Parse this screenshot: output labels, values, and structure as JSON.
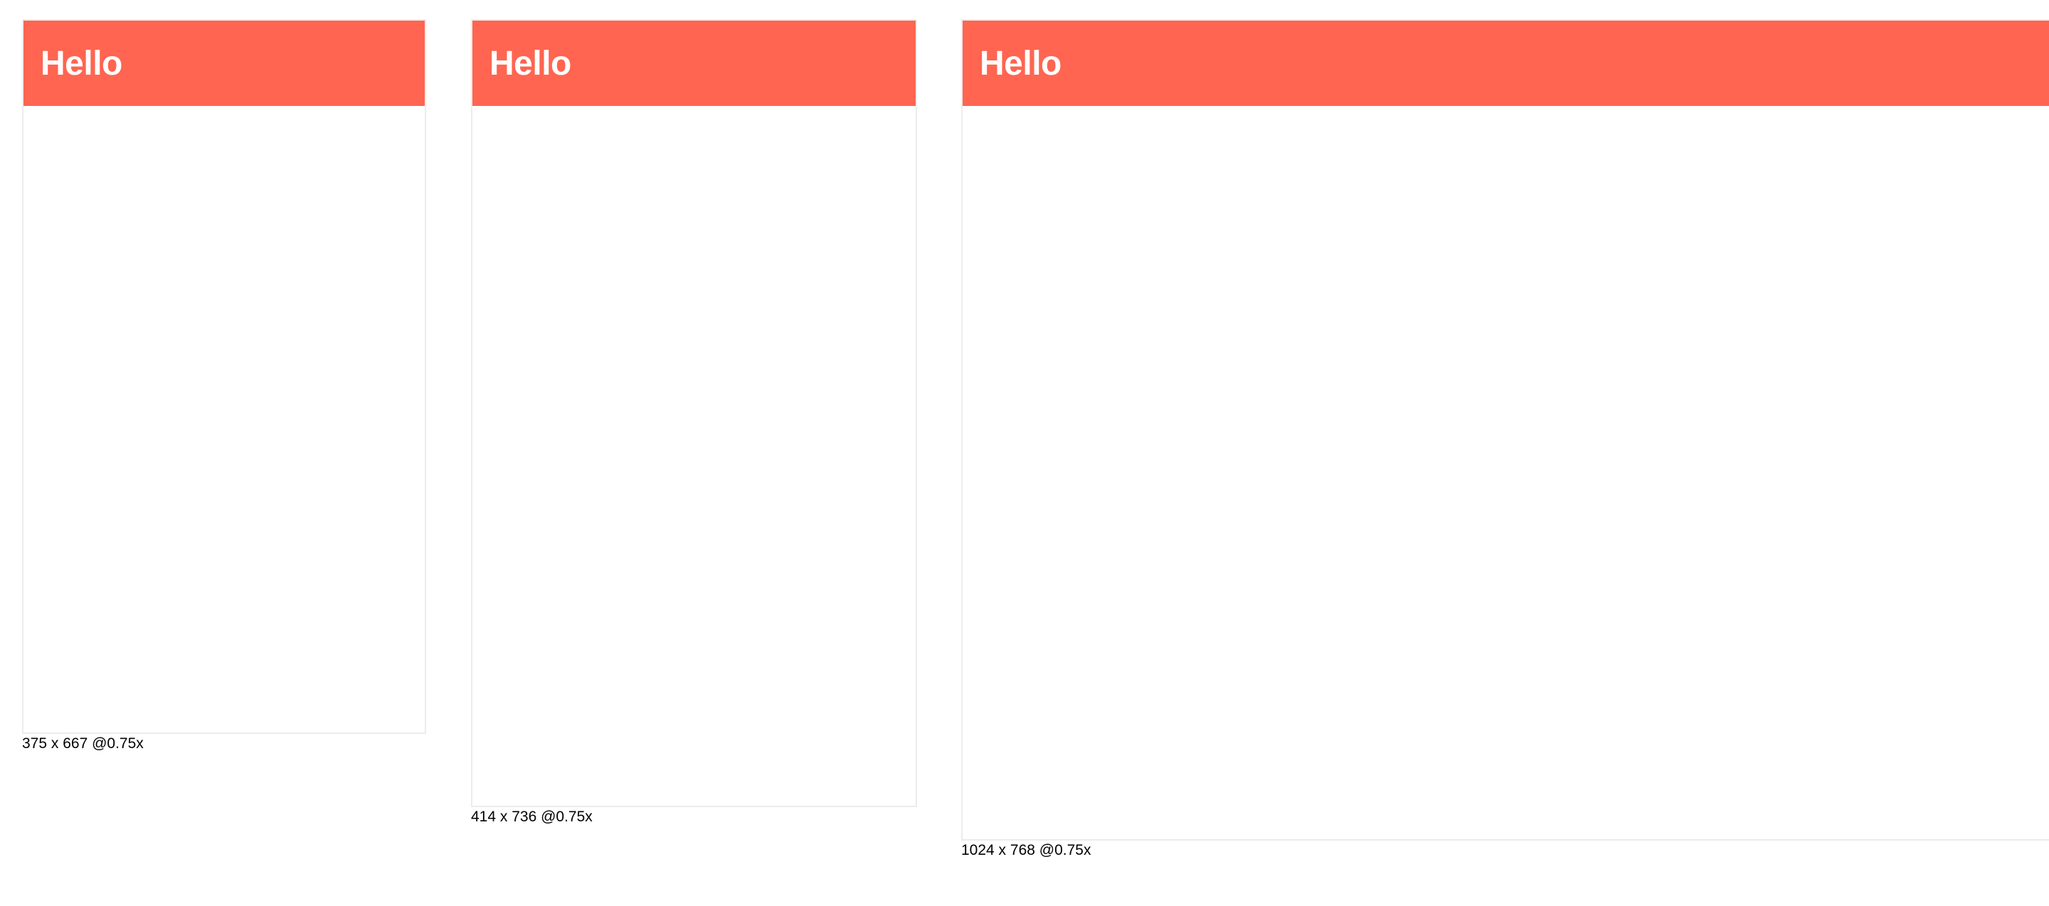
{
  "theme": {
    "accent_color": "#ff6550",
    "frame_border_color": "#ececec",
    "background_color": "#ffffff"
  },
  "frames": [
    {
      "header_title": "Hello",
      "caption": "375 x 667 @0.75x"
    },
    {
      "header_title": "Hello",
      "caption": "414 x 736 @0.75x"
    },
    {
      "header_title": "Hello",
      "caption": "1024 x 768 @0.75x"
    }
  ]
}
